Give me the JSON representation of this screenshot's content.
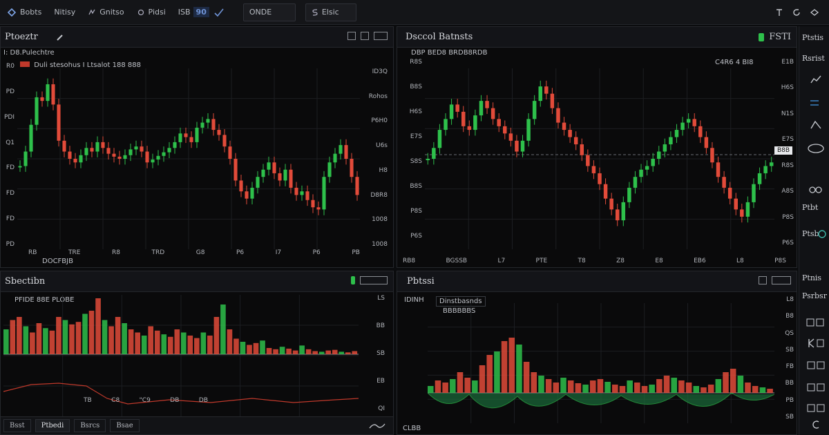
{
  "colors": {
    "up": "#2ec04b",
    "down": "#e24b3a",
    "grid": "#1c1e22",
    "accent": "#3b82c4",
    "background": "#0a0a0b"
  },
  "topbar": {
    "items": [
      {
        "label": "Bobts",
        "icon": "logo-icon"
      },
      {
        "label": "Nitisy",
        "icon": ""
      },
      {
        "label": "Gnitso",
        "icon": "hand-icon"
      },
      {
        "label": "Pidsi",
        "icon": "gear-icon"
      },
      {
        "label": "ISB",
        "icon": "",
        "badge": "90"
      },
      {
        "label": "ONDE",
        "icon": ""
      },
      {
        "label": "Elsic",
        "icon": "s-icon"
      }
    ],
    "right_icons": [
      "pin-icon",
      "refresh-icon",
      "menu-icon"
    ]
  },
  "panels": {
    "p1": {
      "title": "Ptoeztr",
      "info_line1": "I: D8.Pulechtre",
      "info_line2": "Duli stesohus I Ltsalot 188 888",
      "y_ticks": [
        "ID3Q",
        "Rohos",
        "P6H0",
        "U6s",
        "H8",
        "D8R8",
        "1008",
        "1008"
      ],
      "left_ticks": [
        "R0",
        "PD",
        "PDI",
        "Q1",
        "FD",
        "FD",
        "FD",
        "PD"
      ],
      "x_ticks": [
        "RB",
        "TRE",
        "R8",
        "TRD",
        "G8",
        "P6",
        "I7",
        "P6",
        "PB"
      ],
      "x_sub": "DOCFBJB"
    },
    "p2": {
      "title": "Dsccol Batnsts",
      "tools": "FSTI",
      "info_line1": "DBP BED8 BRDB8RDB",
      "info_line2": "C4R6 4 BI8",
      "y_ticks": [
        "E1B",
        "H6S",
        "N1S",
        "E7S",
        "R8S",
        "A8S",
        "P8S",
        "P6S"
      ],
      "left_ticks": [
        "R8S",
        "B8S",
        "H6S",
        "E7S",
        "S8S",
        "B8S",
        "P8S",
        "P6S"
      ],
      "x_ticks": [
        "RB8",
        "BGSSB",
        "L7",
        "PTE",
        "T8",
        "Z8",
        "E8",
        "EB6",
        "L8",
        "P8S"
      ],
      "price_tag": "B8B"
    },
    "p3": {
      "title": "Sbectibn",
      "info_line1": "PFIDE 88E PLOBE",
      "x_ticks": [
        "TB",
        "C8",
        "\"C9",
        "DB",
        "DB"
      ],
      "side_ticks": [
        "LS",
        "BB",
        "SB",
        "EB",
        "QI"
      ],
      "footer_tabs": [
        "Bsst",
        "Ptbedi",
        "Bsrcs",
        "Bsae"
      ]
    },
    "p4": {
      "title": "Pbtssi",
      "info_line1": "IDINH",
      "info_box1": "Dinstbasnds",
      "info_box2": "BBBBBBS",
      "y_ticks": [
        "L8",
        "B8",
        "QS",
        "SB",
        "FB",
        "BB",
        "PB",
        "SB"
      ],
      "x_ticks": [
        "CLBB"
      ]
    }
  },
  "sidebar": {
    "labels": [
      "Ptstis",
      "Rsrist",
      "Ptbt",
      "Ptsb",
      "Ptnis",
      "Psrbsr"
    ],
    "icons": [
      "chart-icon",
      "swap-icon",
      "triangle-icon",
      "wave-icon",
      "people-icon",
      "eye-icon",
      "wave-icon",
      "grid-icon",
      "d-icon",
      "k-icon",
      "people-icon",
      "grid-icon",
      "grid-icon",
      "c-icon"
    ]
  },
  "chart_data": [
    {
      "type": "candlestick",
      "title": "Ptoeztr",
      "values": [
        205,
        225,
        262,
        300,
        295,
        318,
        290,
        240,
        225,
        215,
        210,
        220,
        230,
        225,
        238,
        230,
        222,
        218,
        215,
        220,
        228,
        232,
        225,
        210,
        214,
        219,
        224,
        230,
        238,
        250,
        245,
        238,
        258,
        265,
        270,
        255,
        248,
        232,
        215,
        185,
        170,
        160,
        175,
        190,
        200,
        210,
        195,
        185,
        200,
        175,
        165,
        170,
        158,
        148,
        145,
        190,
        210,
        222,
        234,
        215,
        190,
        165
      ]
    },
    {
      "type": "candlestick",
      "title": "Dsccol Batnsts",
      "values": [
        185,
        200,
        225,
        240,
        260,
        250,
        230,
        225,
        245,
        265,
        255,
        240,
        230,
        220,
        210,
        195,
        210,
        240,
        265,
        285,
        275,
        255,
        235,
        225,
        215,
        205,
        190,
        175,
        165,
        150,
        130,
        115,
        100,
        125,
        145,
        160,
        170,
        175,
        185,
        195,
        205,
        215,
        225,
        235,
        240,
        230,
        215,
        200,
        180,
        160,
        145,
        130,
        115,
        105,
        125,
        150,
        165,
        175,
        180
      ]
    },
    {
      "type": "histogram",
      "title": "Sbectibn",
      "values": [
        40,
        55,
        60,
        45,
        35,
        50,
        42,
        38,
        60,
        55,
        48,
        52,
        65,
        70,
        90,
        55,
        45,
        60,
        50,
        40,
        35,
        30,
        45,
        38,
        32,
        28,
        40,
        35,
        30,
        26,
        35,
        30,
        60,
        80,
        40,
        25,
        20,
        15,
        18,
        22,
        10,
        8,
        12,
        9,
        6,
        14,
        8,
        5,
        4,
        6,
        7,
        4,
        3,
        5
      ]
    },
    {
      "type": "histogram",
      "title": "Pbtssi",
      "values": [
        10,
        18,
        15,
        20,
        30,
        22,
        18,
        40,
        55,
        60,
        75,
        80,
        70,
        45,
        30,
        25,
        20,
        15,
        22,
        18,
        14,
        12,
        18,
        20,
        16,
        12,
        10,
        18,
        15,
        10,
        12,
        20,
        25,
        22,
        18,
        15,
        10,
        8,
        12,
        20,
        30,
        35,
        25,
        15,
        10,
        8,
        6
      ]
    }
  ]
}
